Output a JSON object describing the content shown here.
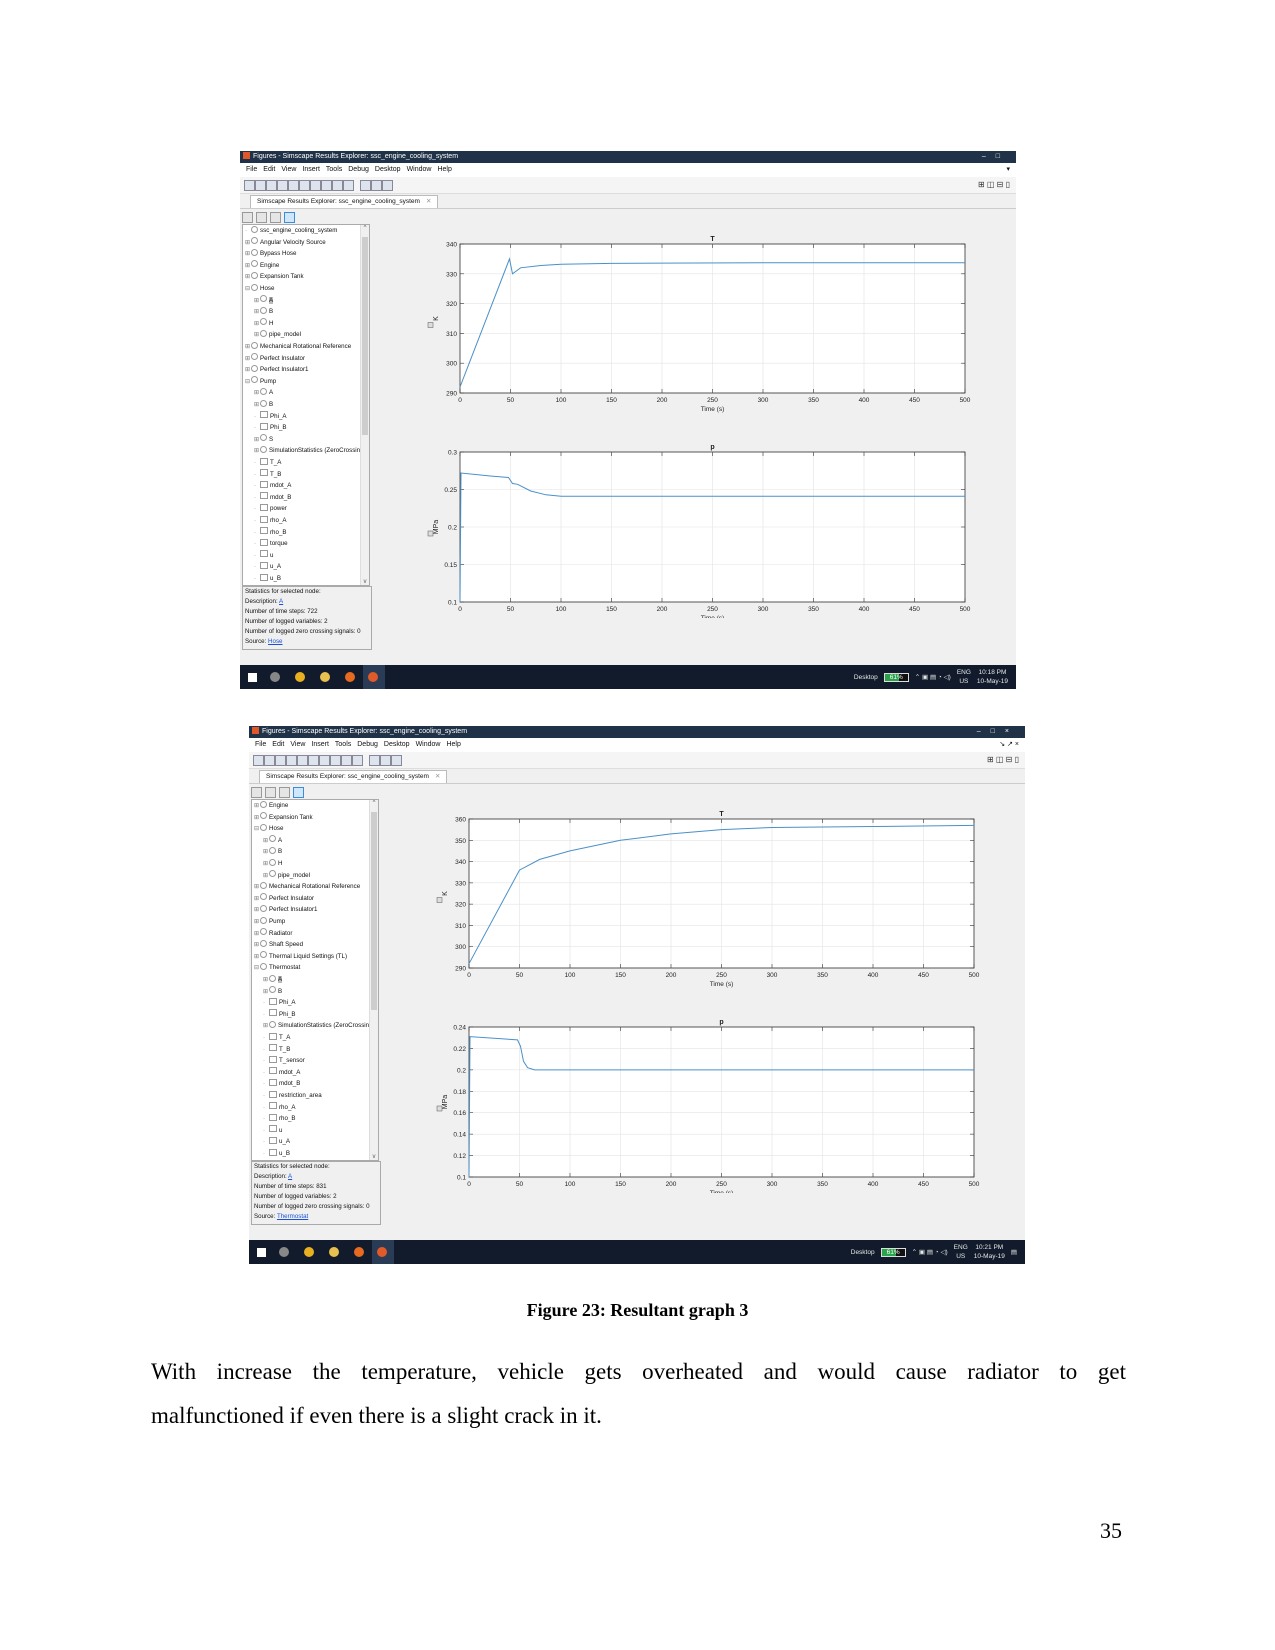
{
  "screenshots": [
    {
      "window_title": "Figures - Simscape Results Explorer: ssc_engine_cooling_system",
      "menu": [
        "File",
        "Edit",
        "View",
        "Insert",
        "Tools",
        "Debug",
        "Desktop",
        "Window",
        "Help"
      ],
      "tab_label": "Simscape Results Explorer: ssc_engine_cooling_system",
      "tree": [
        {
          "label": "ssc_engine_cooling_system",
          "level": 0,
          "expand": "",
          "kind": "node"
        },
        {
          "label": "Angular Velocity Source",
          "level": 0,
          "expand": "+",
          "kind": "node"
        },
        {
          "label": "Bypass Hose",
          "level": 0,
          "expand": "+",
          "kind": "node"
        },
        {
          "label": "Engine",
          "level": 0,
          "expand": "+",
          "kind": "node"
        },
        {
          "label": "Expansion Tank",
          "level": 0,
          "expand": "+",
          "kind": "node"
        },
        {
          "label": "Hose",
          "level": 0,
          "expand": "-",
          "kind": "node"
        },
        {
          "label": "A",
          "level": 1,
          "expand": "+",
          "kind": "node",
          "selected": true
        },
        {
          "label": "B",
          "level": 1,
          "expand": "+",
          "kind": "node"
        },
        {
          "label": "H",
          "level": 1,
          "expand": "+",
          "kind": "node"
        },
        {
          "label": "pipe_model",
          "level": 1,
          "expand": "+",
          "kind": "node"
        },
        {
          "label": "Mechanical Rotational Reference",
          "level": 0,
          "expand": "+",
          "kind": "node"
        },
        {
          "label": "Perfect Insulator",
          "level": 0,
          "expand": "+",
          "kind": "node"
        },
        {
          "label": "Perfect Insulator1",
          "level": 0,
          "expand": "+",
          "kind": "node"
        },
        {
          "label": "Pump",
          "level": 0,
          "expand": "-",
          "kind": "node"
        },
        {
          "label": "A",
          "level": 1,
          "expand": "+",
          "kind": "node"
        },
        {
          "label": "B",
          "level": 1,
          "expand": "+",
          "kind": "node"
        },
        {
          "label": "Phi_A",
          "level": 1,
          "expand": "",
          "kind": "leaf"
        },
        {
          "label": "Phi_B",
          "level": 1,
          "expand": "",
          "kind": "leaf"
        },
        {
          "label": "S",
          "level": 1,
          "expand": "+",
          "kind": "node"
        },
        {
          "label": "SimulationStatistics (ZeroCrossings)",
          "level": 1,
          "expand": "+",
          "kind": "node"
        },
        {
          "label": "T_A",
          "level": 1,
          "expand": "",
          "kind": "leaf"
        },
        {
          "label": "T_B",
          "level": 1,
          "expand": "",
          "kind": "leaf"
        },
        {
          "label": "mdot_A",
          "level": 1,
          "expand": "",
          "kind": "leaf"
        },
        {
          "label": "mdot_B",
          "level": 1,
          "expand": "",
          "kind": "leaf"
        },
        {
          "label": "power",
          "level": 1,
          "expand": "",
          "kind": "leaf"
        },
        {
          "label": "rho_A",
          "level": 1,
          "expand": "",
          "kind": "leaf"
        },
        {
          "label": "rho_B",
          "level": 1,
          "expand": "",
          "kind": "leaf"
        },
        {
          "label": "torque",
          "level": 1,
          "expand": "",
          "kind": "leaf"
        },
        {
          "label": "u",
          "level": 1,
          "expand": "",
          "kind": "leaf"
        },
        {
          "label": "u_A",
          "level": 1,
          "expand": "",
          "kind": "leaf"
        },
        {
          "label": "u_B",
          "level": 1,
          "expand": "",
          "kind": "leaf"
        }
      ],
      "stats": {
        "heading": "Statistics for selected node:",
        "description_label": "Description: ",
        "description_link": "A",
        "time_steps": "Number of time steps: 722",
        "logged_vars": "Number of logged variables: 2",
        "zero_crossing": "Number of logged zero crossing signals: 0",
        "source_label": "Source: ",
        "source_link": "Hose"
      },
      "taskbar": {
        "desktop": "Desktop",
        "battery": "61%",
        "lang1": "ENG",
        "lang2": "US",
        "time": "10:18 PM",
        "date": "10-May-19"
      }
    },
    {
      "window_title": "Figures - Simscape Results Explorer: ssc_engine_cooling_system",
      "menu": [
        "File",
        "Edit",
        "View",
        "Insert",
        "Tools",
        "Debug",
        "Desktop",
        "Window",
        "Help"
      ],
      "tab_label": "Simscape Results Explorer: ssc_engine_cooling_system",
      "tree": [
        {
          "label": "Engine",
          "level": 0,
          "expand": "+",
          "kind": "node"
        },
        {
          "label": "Expansion Tank",
          "level": 0,
          "expand": "+",
          "kind": "node"
        },
        {
          "label": "Hose",
          "level": 0,
          "expand": "-",
          "kind": "node"
        },
        {
          "label": "A",
          "level": 1,
          "expand": "+",
          "kind": "node"
        },
        {
          "label": "B",
          "level": 1,
          "expand": "+",
          "kind": "node"
        },
        {
          "label": "H",
          "level": 1,
          "expand": "+",
          "kind": "node"
        },
        {
          "label": "pipe_model",
          "level": 1,
          "expand": "+",
          "kind": "node"
        },
        {
          "label": "Mechanical Rotational Reference",
          "level": 0,
          "expand": "+",
          "kind": "node"
        },
        {
          "label": "Perfect Insulator",
          "level": 0,
          "expand": "+",
          "kind": "node"
        },
        {
          "label": "Perfect Insulator1",
          "level": 0,
          "expand": "+",
          "kind": "node"
        },
        {
          "label": "Pump",
          "level": 0,
          "expand": "+",
          "kind": "node"
        },
        {
          "label": "Radiator",
          "level": 0,
          "expand": "+",
          "kind": "node"
        },
        {
          "label": "Shaft Speed",
          "level": 0,
          "expand": "+",
          "kind": "node"
        },
        {
          "label": "Thermal Liquid Settings (TL)",
          "level": 0,
          "expand": "+",
          "kind": "node"
        },
        {
          "label": "Thermostat",
          "level": 0,
          "expand": "-",
          "kind": "node"
        },
        {
          "label": "A",
          "level": 1,
          "expand": "+",
          "kind": "node",
          "selected": true
        },
        {
          "label": "B",
          "level": 1,
          "expand": "+",
          "kind": "node"
        },
        {
          "label": "Phi_A",
          "level": 1,
          "expand": "",
          "kind": "leaf"
        },
        {
          "label": "Phi_B",
          "level": 1,
          "expand": "",
          "kind": "leaf"
        },
        {
          "label": "SimulationStatistics (ZeroCrossings)",
          "level": 1,
          "expand": "+",
          "kind": "node"
        },
        {
          "label": "T_A",
          "level": 1,
          "expand": "",
          "kind": "leaf"
        },
        {
          "label": "T_B",
          "level": 1,
          "expand": "",
          "kind": "leaf"
        },
        {
          "label": "T_sensor",
          "level": 1,
          "expand": "",
          "kind": "leaf"
        },
        {
          "label": "mdot_A",
          "level": 1,
          "expand": "",
          "kind": "leaf"
        },
        {
          "label": "mdot_B",
          "level": 1,
          "expand": "",
          "kind": "leaf"
        },
        {
          "label": "restriction_area",
          "level": 1,
          "expand": "",
          "kind": "leaf"
        },
        {
          "label": "rho_A",
          "level": 1,
          "expand": "",
          "kind": "leaf"
        },
        {
          "label": "rho_B",
          "level": 1,
          "expand": "",
          "kind": "leaf"
        },
        {
          "label": "u",
          "level": 1,
          "expand": "",
          "kind": "leaf"
        },
        {
          "label": "u_A",
          "level": 1,
          "expand": "",
          "kind": "leaf"
        },
        {
          "label": "u_B",
          "level": 1,
          "expand": "",
          "kind": "leaf"
        }
      ],
      "stats": {
        "heading": "Statistics for selected node:",
        "description_label": "Description: ",
        "description_link": "A",
        "time_steps": "Number of time steps: 831",
        "logged_vars": "Number of logged variables: 2",
        "zero_crossing": "Number of logged zero crossing signals: 0",
        "source_label": "Source: ",
        "source_link": "Thermostat"
      },
      "taskbar": {
        "desktop": "Desktop",
        "battery": "61%",
        "lang1": "ENG",
        "lang2": "US",
        "time": "10:21 PM",
        "date": "10-May-19"
      }
    }
  ],
  "chart_data": [
    {
      "type": "line",
      "title": "T",
      "xlabel": "Time (s)",
      "ylabel": "K",
      "xlim": [
        0,
        500
      ],
      "ylim": [
        290,
        340
      ],
      "xticks": [
        0,
        50,
        100,
        150,
        200,
        250,
        300,
        350,
        400,
        450,
        500
      ],
      "yticks": [
        290,
        300,
        310,
        320,
        330,
        340
      ],
      "grid": true,
      "color": "#4a90c8",
      "x": [
        0,
        49,
        52,
        60,
        80,
        100,
        150,
        200,
        300,
        400,
        500
      ],
      "y": [
        292,
        335,
        330,
        332,
        332.8,
        333.2,
        333.5,
        333.6,
        333.7,
        333.7,
        333.7
      ]
    },
    {
      "type": "line",
      "title": "p",
      "xlabel": "Time (s)",
      "ylabel": "MPa",
      "xlim": [
        0,
        500
      ],
      "ylim": [
        0.1,
        0.3
      ],
      "xticks": [
        0,
        50,
        100,
        150,
        200,
        250,
        300,
        350,
        400,
        450,
        500
      ],
      "yticks": [
        0.1,
        0.15,
        0.2,
        0.25,
        0.3
      ],
      "grid": true,
      "color": "#4a90c8",
      "x": [
        0,
        1,
        30,
        48,
        52,
        57,
        70,
        85,
        100,
        200,
        500
      ],
      "y": [
        0.1,
        0.272,
        0.268,
        0.266,
        0.258,
        0.257,
        0.248,
        0.243,
        0.241,
        0.241,
        0.241
      ]
    },
    {
      "type": "line",
      "title": "T",
      "xlabel": "Time (s)",
      "ylabel": "K",
      "xlim": [
        0,
        500
      ],
      "ylim": [
        290,
        360
      ],
      "xticks": [
        0,
        50,
        100,
        150,
        200,
        250,
        300,
        350,
        400,
        450,
        500
      ],
      "yticks": [
        290,
        300,
        310,
        320,
        330,
        340,
        350,
        360
      ],
      "grid": true,
      "color": "#4a90c8",
      "x": [
        0,
        50,
        70,
        100,
        150,
        200,
        250,
        300,
        400,
        500
      ],
      "y": [
        292,
        336,
        341,
        345,
        350,
        353,
        355,
        356,
        356.5,
        357
      ]
    },
    {
      "type": "line",
      "title": "p",
      "xlabel": "Time (s)",
      "ylabel": "MPa",
      "xlim": [
        0,
        500
      ],
      "ylim": [
        0.1,
        0.24
      ],
      "xticks": [
        0,
        50,
        100,
        150,
        200,
        250,
        300,
        350,
        400,
        450,
        500
      ],
      "yticks": [
        0.1,
        0.12,
        0.14,
        0.16,
        0.18,
        0.2,
        0.22,
        0.24
      ],
      "grid": true,
      "color": "#4a90c8",
      "x": [
        0,
        1,
        48,
        51,
        54,
        58,
        65,
        100,
        500
      ],
      "y": [
        0.1,
        0.231,
        0.228,
        0.222,
        0.208,
        0.202,
        0.2,
        0.2,
        0.2
      ]
    }
  ],
  "caption": "Figure 23: Resultant graph 3",
  "paragraph": {
    "line1": "With increase the temperature, vehicle gets overheated and would cause radiator to get",
    "line2": "malfunctioned if even there is a slight crack in it."
  },
  "page_number": "35"
}
